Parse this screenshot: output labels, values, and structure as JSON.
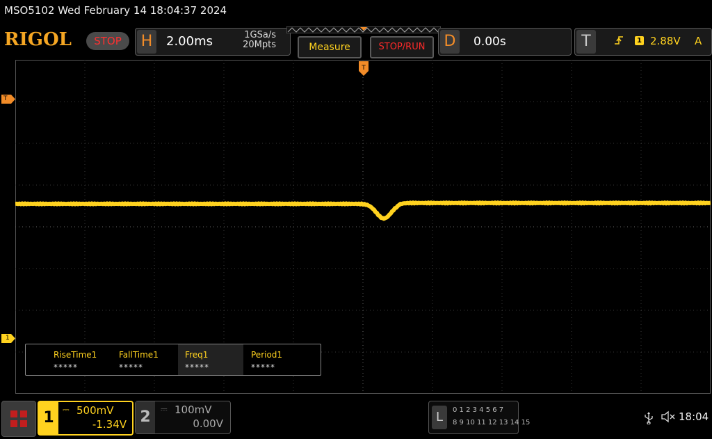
{
  "status_line": "MSO5102  Wed February 14 18:04:37 2024",
  "brand": {
    "logo": "RIGOL",
    "run_state": "STOP"
  },
  "horizontal": {
    "letter": "H",
    "timebase": "2.00ms",
    "sample_rate": "1GSa/s",
    "memory_depth": "20Mpts"
  },
  "buttons": {
    "measure": "Measure",
    "stop_run": "STOP/RUN"
  },
  "delay": {
    "letter": "D",
    "value": "0.00s"
  },
  "trigger": {
    "letter": "T",
    "edge_icon": "rising-edge-icon",
    "source": "1",
    "level": "2.88V",
    "mode": "A"
  },
  "markers": {
    "trigger_level": "T",
    "ch1_ground": "1"
  },
  "measurements": [
    {
      "label": "RiseTime1",
      "value": "*****"
    },
    {
      "label": "FallTime1",
      "value": "*****"
    },
    {
      "label": "Freq1",
      "value": "*****"
    },
    {
      "label": "Period1",
      "value": "*****"
    }
  ],
  "channels": [
    {
      "num": "1",
      "coupling_icon": "dc-coupling-icon",
      "scale": "500mV",
      "offset": "-1.34V",
      "active": true
    },
    {
      "num": "2",
      "coupling_icon": "dc-coupling-icon",
      "scale": "100mV",
      "offset": "0.00V",
      "active": false
    }
  ],
  "logic_analyzer": {
    "letter": "L",
    "row1": "0 1 2 3   4 5 6 7",
    "row2": "8 9 10 11 12 13 14 15"
  },
  "clock": "18:04",
  "colors": {
    "ch1": "#ffd21f",
    "accent": "#f28c28",
    "stop": "#ff2a2a",
    "grid": "#3a3a3a"
  },
  "waveform": {
    "grid_divisions": {
      "horizontal": 10,
      "vertical": 8
    },
    "baseline_div": 0.55,
    "dip_depth_div": 0.35,
    "dip_center_time_ms": 0.6,
    "dip_width_ms": 0.3
  }
}
